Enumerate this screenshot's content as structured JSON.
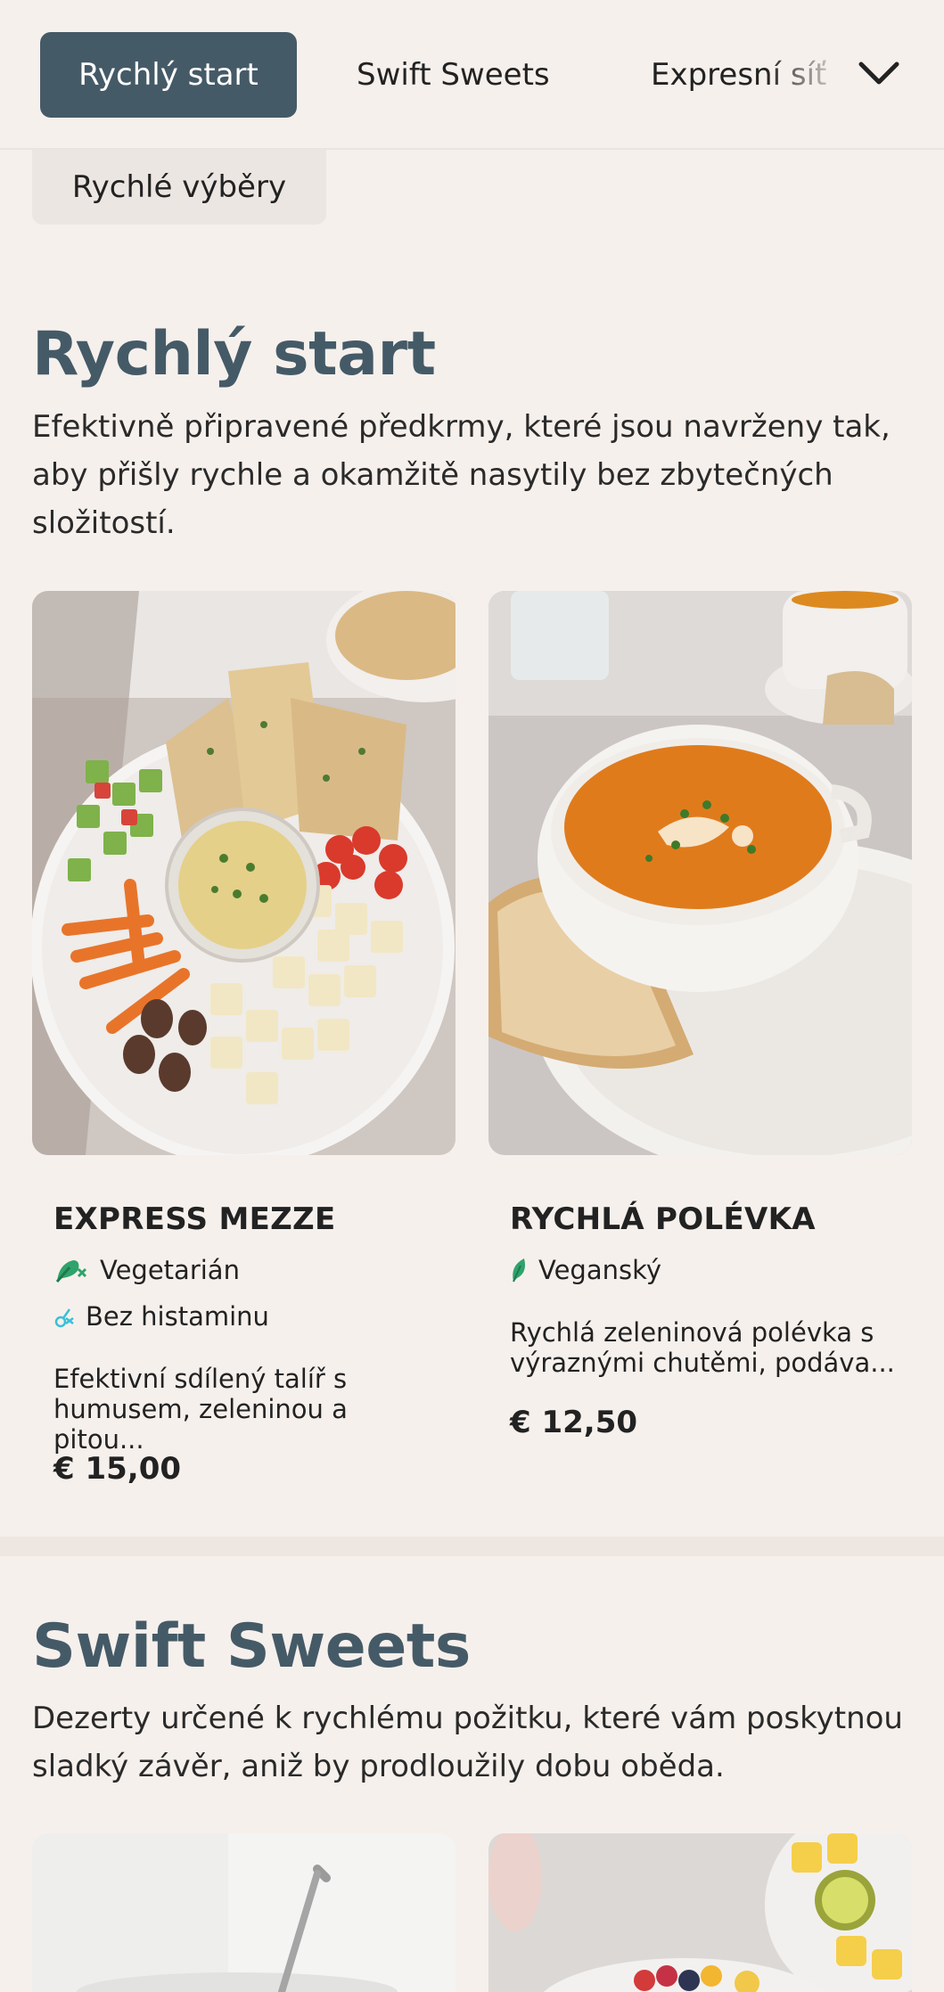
{
  "nav": {
    "tabs": [
      {
        "label": "Rychlý start",
        "active": true
      },
      {
        "label": "Swift Sweets",
        "active": false
      },
      {
        "label": "Expresní síť",
        "active": false
      }
    ],
    "more_icon": "chevron-down-icon",
    "subcategory": "Rychlé výběry"
  },
  "sections": [
    {
      "title": "Rychlý start",
      "description": "Efektivně připravené předkrmy, které jsou navrženy tak, aby přišly rychle a okamžitě nasytily bez zbytečných složitostí.",
      "items": [
        {
          "name": "EXPRESS MEZZE",
          "tags": [
            {
              "label": "Vegetarián",
              "icon": "vegetarian-icon"
            },
            {
              "label": "Bez histaminu",
              "icon": "histamine-free-icon"
            }
          ],
          "description": "Efektivní sdílený talíř s humusem, zeleninou a pitou...",
          "price": "€ 15,00"
        },
        {
          "name": "RYCHLÁ POLÉVKA",
          "tags": [
            {
              "label": "Veganský",
              "icon": "vegan-leaf-icon"
            }
          ],
          "description": "Rychlá zeleninová polévka s výraznými chutěmi, podáva...",
          "price": "€ 12,50"
        }
      ]
    },
    {
      "title": "Swift Sweets",
      "description": "Dezerty určené k rychlému požitku, které vám poskytnou sladký závěr, aniž by prodloužily dobu oběda."
    }
  ],
  "colors": {
    "accent": "#455a67",
    "background": "#f6f0ec",
    "vegetarian": "#2fa36b",
    "histamine": "#3bbfd6"
  }
}
